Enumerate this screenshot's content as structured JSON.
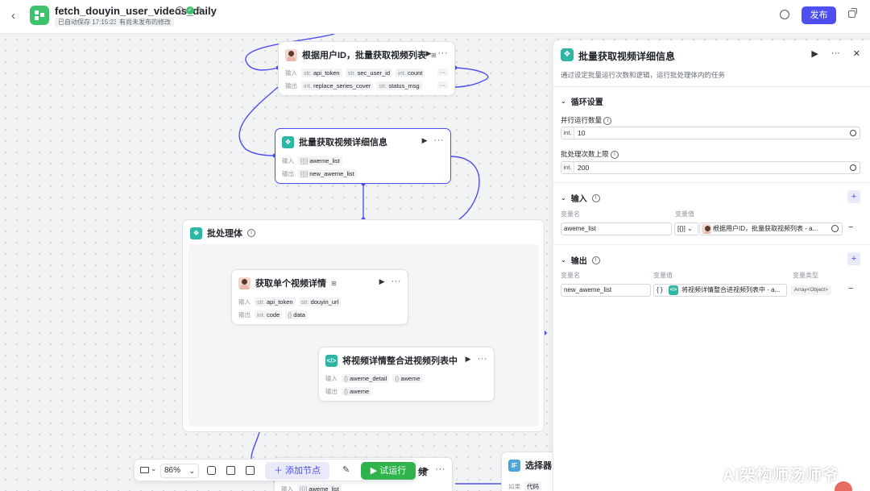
{
  "header": {
    "title": "fetch_douyin_user_videos_daily",
    "autosave": "已自动保存 17:15:23",
    "unpublished": "有尚未发布的修改",
    "publish": "发布"
  },
  "nodes": {
    "fetch": {
      "title": "根据用户ID，批量获取视频列表",
      "in_label": "输入",
      "out_label": "输出",
      "inputs": [
        {
          "type": "str.",
          "name": "api_token"
        },
        {
          "type": "str.",
          "name": "sec_user_id"
        },
        {
          "type": "int.",
          "name": "count"
        }
      ],
      "outputs": [
        {
          "type": "int.",
          "name": "replace_series_cover"
        },
        {
          "type": "str.",
          "name": "status_msg"
        }
      ],
      "more": "···"
    },
    "batch": {
      "title": "批量获取视频详细信息",
      "in_label": "输入",
      "out_label": "输出",
      "input": {
        "type": "[{}]",
        "name": "aweme_list"
      },
      "output": {
        "type": "[{}]",
        "name": "new_aweme_list"
      }
    },
    "batch_body": {
      "title": "批处理体"
    },
    "single": {
      "title": "获取单个视频详情",
      "in_label": "输入",
      "out_label": "输出",
      "inputs": [
        {
          "type": "str.",
          "name": "api_token"
        },
        {
          "type": "str.",
          "name": "douyin_url"
        }
      ],
      "outputs": [
        {
          "type": "int.",
          "name": "code"
        },
        {
          "type": "{}",
          "name": "data"
        }
      ]
    },
    "merge": {
      "title": "将视频详情整合进视频列表中",
      "in_label": "输入",
      "out_label": "输出",
      "inputs": [
        {
          "type": "{}",
          "name": "aweme_detail"
        },
        {
          "type": "{}",
          "name": "aweme"
        }
      ],
      "outputs": [
        {
          "type": "{}",
          "name": "aweme"
        }
      ]
    },
    "bottom": {
      "title_fragment": "频",
      "in_label": "输入",
      "input": {
        "type": "[{}]",
        "name": "aweme_list"
      }
    },
    "selector": {
      "title": "选择器",
      "if_label": "如果",
      "code": "代码"
    }
  },
  "toolbar": {
    "zoom": "86%",
    "add_node": "＋ 添加节点",
    "run": "▶ 试运行"
  },
  "panel": {
    "title": "批量获取视频详细信息",
    "description": "通过设定批量运行次数和逻辑，运行批处理体内的任务",
    "loop": {
      "heading": "循环设置",
      "parallel_label": "并行运行数量",
      "parallel_value": "10",
      "limit_label": "批处理次数上限",
      "limit_value": "200",
      "prefix": "int."
    },
    "input": {
      "heading": "输入",
      "col_name": "变量名",
      "col_value": "变量值",
      "var_name": "aweme_list",
      "var_type": "[{}]",
      "var_ref": "根据用户ID，批量获取视频列表 - a..."
    },
    "output": {
      "heading": "输出",
      "col_name": "变量名",
      "col_value": "变量值",
      "col_type": "变量类型",
      "var_name": "new_aweme_list",
      "var_ref": "将视频详情整合进视频列表中 - a...",
      "var_type": "Array<Object>"
    }
  },
  "watermark": "AI架构师汤师爷",
  "colors": {
    "accent": "#4e4ff0",
    "run": "#30b34d",
    "node_icon": "#2fb5a3",
    "app_icon": "#3ec26d"
  }
}
